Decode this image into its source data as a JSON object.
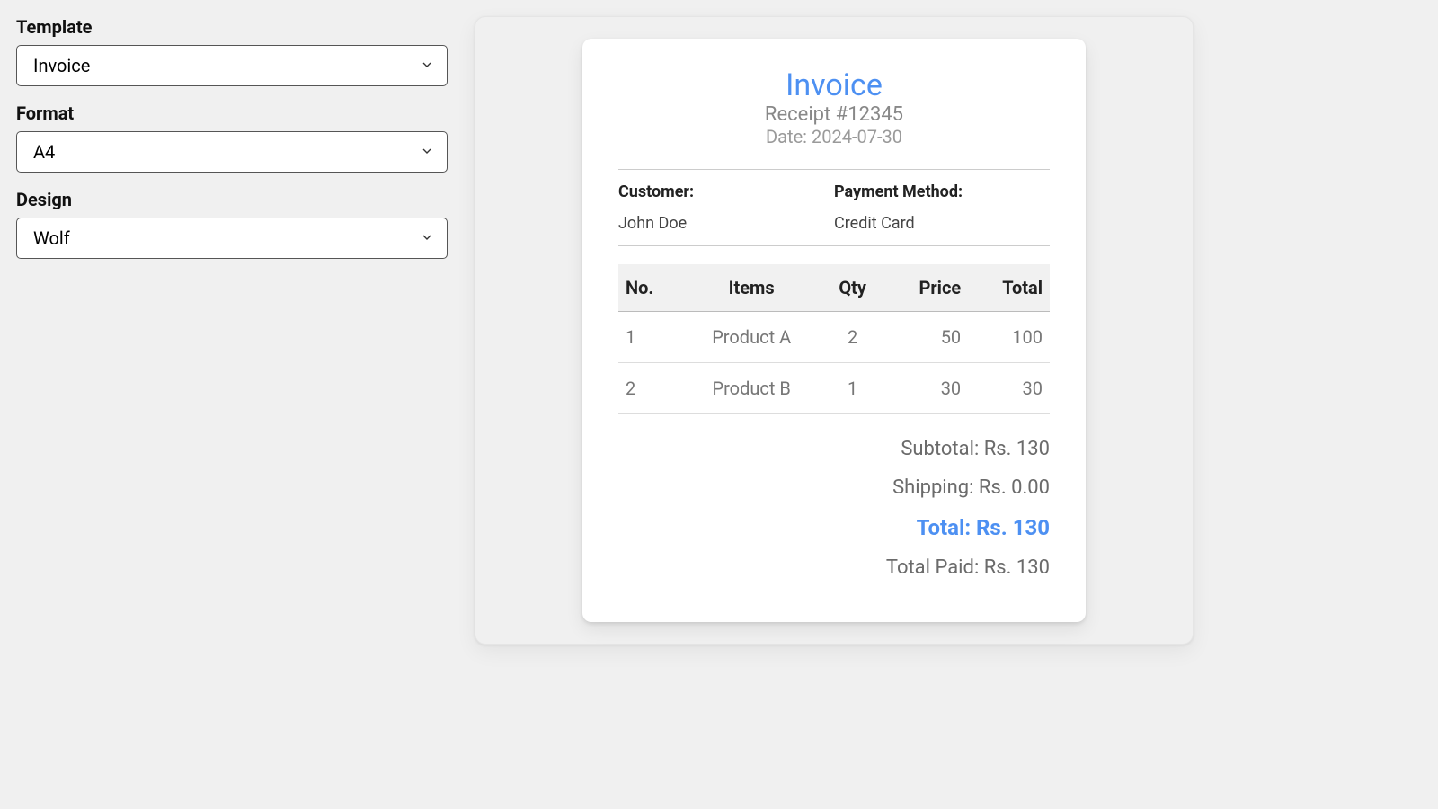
{
  "sidebar": {
    "template_label": "Template",
    "template_value": "Invoice",
    "format_label": "Format",
    "format_value": "A4",
    "design_label": "Design",
    "design_value": "Wolf"
  },
  "invoice": {
    "title": "Invoice",
    "receipt_line": "Receipt #12345",
    "date_line": "Date: 2024-07-30",
    "customer_label": "Customer:",
    "customer_value": "John Doe",
    "payment_label": "Payment Method:",
    "payment_value": "Credit Card",
    "headers": {
      "no": "No.",
      "items": "Items",
      "qty": "Qty",
      "price": "Price",
      "total": "Total"
    },
    "rows": [
      {
        "no": "1",
        "item": "Product A",
        "qty": "2",
        "price": "50",
        "total": "100"
      },
      {
        "no": "2",
        "item": "Product B",
        "qty": "1",
        "price": "30",
        "total": "30"
      }
    ],
    "subtotal_line": "Subtotal: Rs. 130",
    "shipping_line": "Shipping: Rs. 0.00",
    "total_line": "Total: Rs. 130",
    "paid_line": "Total Paid: Rs. 130"
  }
}
